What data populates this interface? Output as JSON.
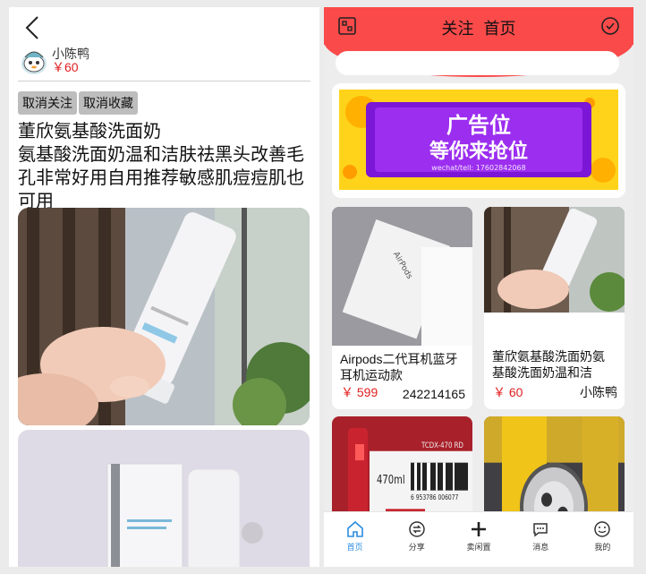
{
  "detail": {
    "user": {
      "name": "小陈鸭",
      "price": "￥60"
    },
    "buttons": {
      "unfollow": "取消关注",
      "unfavorite": "取消收藏"
    },
    "title": "董欣氨基酸洗面奶\n氨基酸洗面奶温和洁肤祛黑头改善毛孔非常好用自用推荐敏感肌痘痘肌也可用"
  },
  "home": {
    "tabs": [
      "关注",
      "首页"
    ],
    "search": {
      "value": "",
      "placeholder": ""
    },
    "banner": {
      "line1": "广告位",
      "line2": "等你来抢位",
      "contact": "wechat/tell: 17602842068"
    },
    "products": [
      {
        "title": "Airpods二代耳机蓝牙耳机运动款",
        "price": "￥ 599",
        "user": "242214165"
      },
      {
        "title": "董欣氨基酸洗面奶氨基酸洗面奶温和洁",
        "price": "￥ 60",
        "user": "小陈鸭"
      },
      {
        "label": "TCDX-470 RD",
        "size": "470ml",
        "code": "6 953786 006077"
      },
      {
        "title": ""
      }
    ],
    "tabbar": [
      "首页",
      "分享",
      "卖闲置",
      "消息",
      "我的"
    ]
  },
  "colors": {
    "accent": "#fa4a4a",
    "price": "#e02020",
    "tabActive": "#2b8de0"
  }
}
